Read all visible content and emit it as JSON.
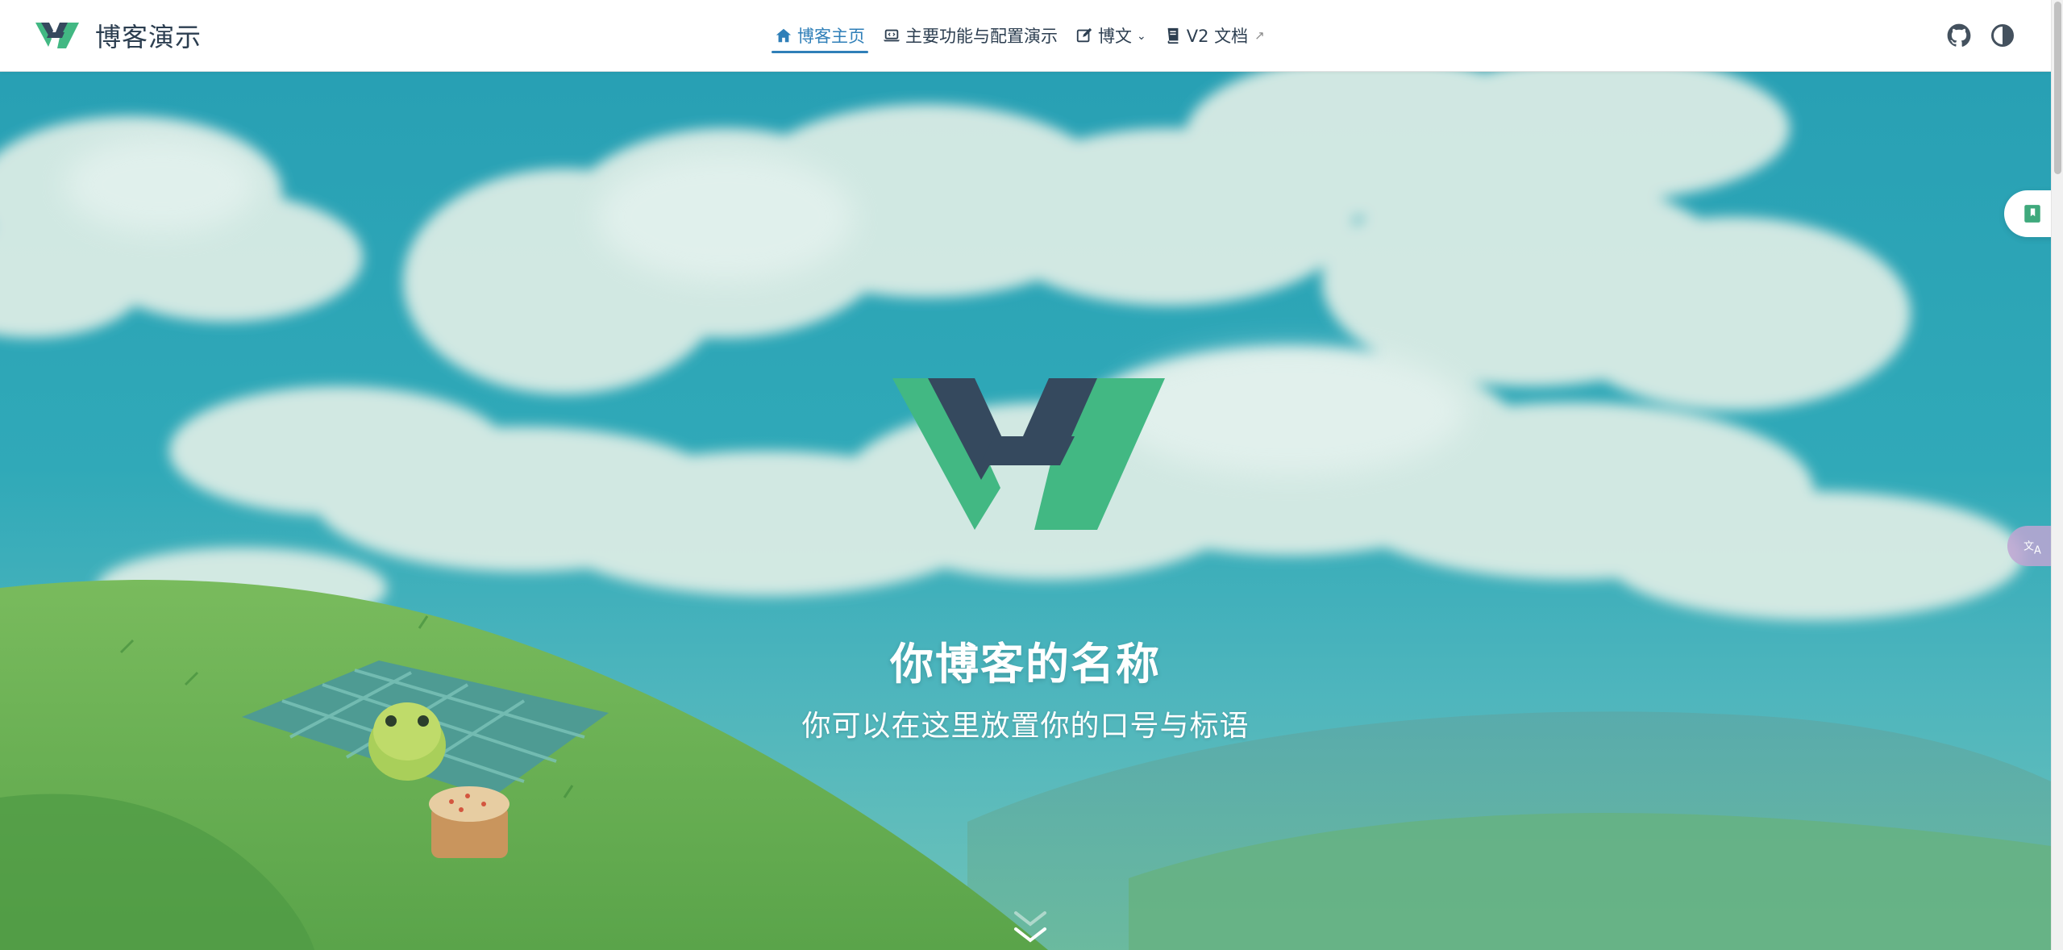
{
  "navbar": {
    "site_title": "博客演示",
    "links": [
      {
        "label": "博客主页",
        "icon": "home-icon",
        "active": true
      },
      {
        "label": "主要功能与配置演示",
        "icon": "laptop-code-icon",
        "active": false
      },
      {
        "label": "博文",
        "icon": "edit-icon",
        "active": false,
        "dropdown": true
      },
      {
        "label": "V2 文档",
        "icon": "book-icon",
        "active": false,
        "external": true
      }
    ],
    "right_icons": [
      "github-icon",
      "theme-toggle-icon"
    ]
  },
  "hero": {
    "title": "你博客的名称",
    "description": "你可以在这里放置你的口号与标语"
  },
  "widgets": {
    "toc_toggle_icon": "bookmark-icon",
    "translate_icon": "translate-icon"
  },
  "colors": {
    "accent": "#2f7fb8",
    "logo_green": "#42b883",
    "logo_dark": "#35495e",
    "sky": "#2ba7b5"
  }
}
